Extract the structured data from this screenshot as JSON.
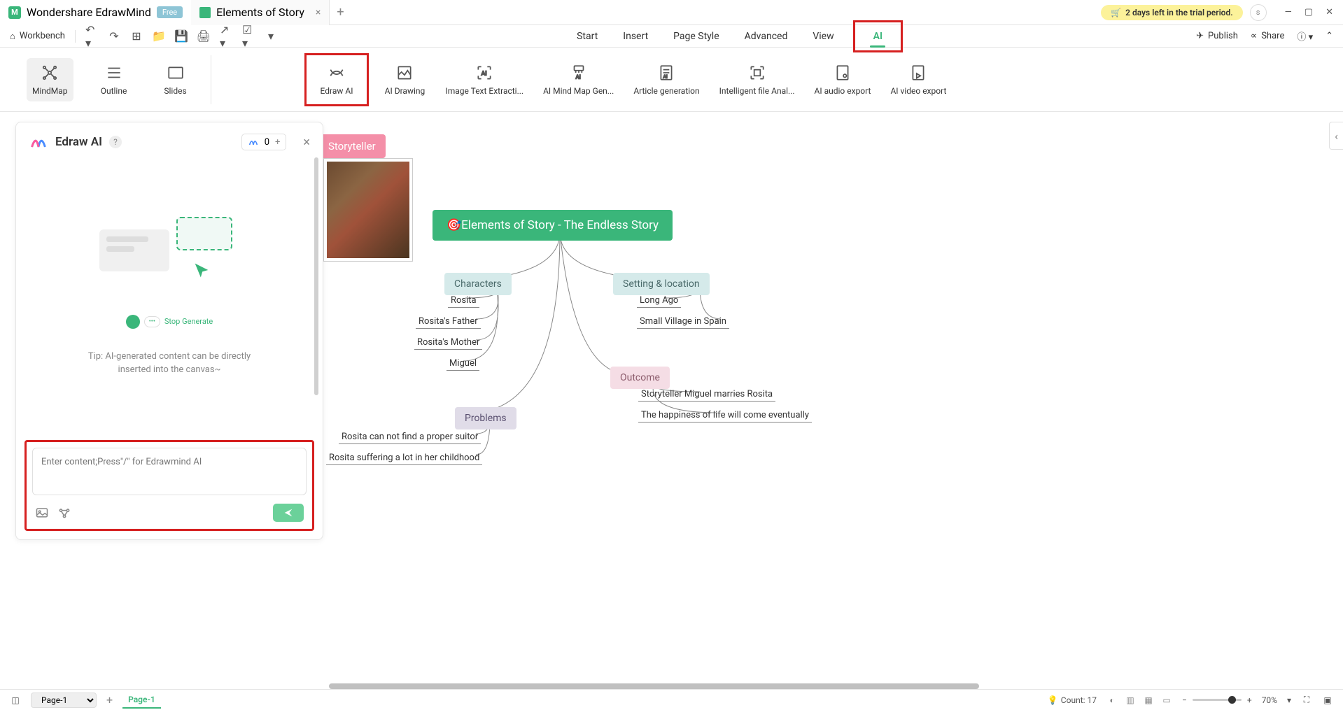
{
  "title_bar": {
    "app_name": "Wondershare EdrawMind",
    "free_badge": "Free",
    "file_tab": "Elements of Story",
    "trial_text": "2 days left in the trial period.",
    "user_initial": "s"
  },
  "toolbar": {
    "workbench": "Workbench"
  },
  "menu": {
    "start": "Start",
    "insert": "Insert",
    "page_style": "Page Style",
    "advanced": "Advanced",
    "view": "View",
    "ai": "AI"
  },
  "top_right": {
    "publish": "Publish",
    "share": "Share"
  },
  "ribbon": {
    "mindmap": "MindMap",
    "outline": "Outline",
    "slides": "Slides",
    "edraw_ai": "Edraw AI",
    "ai_drawing": "AI Drawing",
    "image_text": "Image Text Extracti...",
    "ai_mindmap": "AI Mind Map Gen...",
    "article": "Article generation",
    "file_anal": "Intelligent file Anal...",
    "audio_export": "AI audio export",
    "video_export": "AI video export"
  },
  "ai_panel": {
    "title": "Edraw AI",
    "credit": "0",
    "stop_generate": "Stop Generate",
    "tip_line1": "Tip: AI-generated content can be directly",
    "tip_line2": "inserted into the canvas~",
    "placeholder": "Enter content;Press\"/\" for Edrawmind AI"
  },
  "mindmap": {
    "storyteller": "Storyteller",
    "main": "🎯Elements of Story - The Endless Story",
    "characters": "Characters",
    "char_items": [
      "Rosita",
      "Rosita's Father",
      "Rosita's Mother",
      "Miguel"
    ],
    "setting": "Setting & location",
    "setting_items": [
      "Long Ago",
      "Small Village in Spain"
    ],
    "problems": "Problems",
    "problem_items": [
      "Rosita can not find a proper suitor",
      "Rosita suffering a lot in her childhood"
    ],
    "outcome": "Outcome",
    "outcome_items": [
      "Storyteller Miguel marries Rosita",
      "The happiness of life will come eventually"
    ]
  },
  "status": {
    "page_select": "Page-1",
    "page_tab": "Page-1",
    "count": "Count: 17",
    "zoom": "70%"
  }
}
